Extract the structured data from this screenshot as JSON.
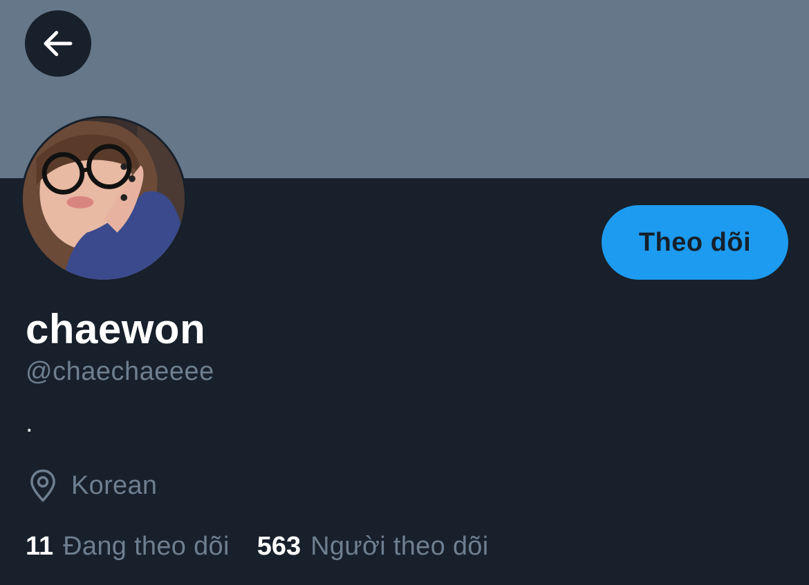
{
  "header": {
    "back_icon": "arrow-left-icon",
    "banner_color": "#667789"
  },
  "profile": {
    "avatar": "profile-photo",
    "follow_label": "Theo dõi",
    "display_name": "chaewon",
    "handle": "@chaechaeeee",
    "bio": ".",
    "location_icon": "map-pin-icon",
    "location": "Korean"
  },
  "stats": {
    "following_count": "11",
    "following_label": "Đang theo dõi",
    "followers_count": "563",
    "followers_label": "Người theo dõi"
  },
  "colors": {
    "background": "#17202b",
    "accent": "#1d9bf0",
    "muted_text": "#6e7f90"
  }
}
